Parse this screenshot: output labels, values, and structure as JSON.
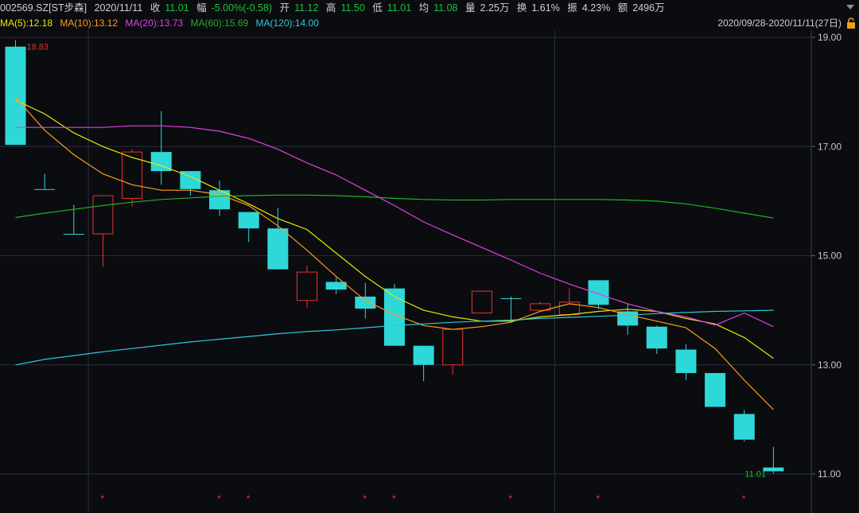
{
  "header": {
    "code": "002569.SZ[ST步森]",
    "date": "2020/11/11",
    "close_label": "收",
    "close": "11.01",
    "change_label": "幅",
    "change": "-5.00%(-0.58)",
    "open_label": "开",
    "open": "11.12",
    "high_label": "高",
    "high": "11.50",
    "low_label": "低",
    "low": "11.01",
    "avg_label": "均",
    "avg": "11.08",
    "vol_label": "量",
    "vol": "2.25万",
    "turnover_label": "换",
    "turnover": "1.61%",
    "amp_label": "振",
    "amp": "4.23%",
    "amount_label": "额",
    "amount": "2496万"
  },
  "ma_legend": [
    {
      "label": "MA(5):12.18",
      "color": "#e8e800"
    },
    {
      "label": "MA(10):13.12",
      "color": "#ff9c1a"
    },
    {
      "label": "MA(20):13.73",
      "color": "#e040e0"
    },
    {
      "label": "MA(60):15.69",
      "color": "#22b022"
    },
    {
      "label": "MA(120):14.00",
      "color": "#30c8d8"
    }
  ],
  "range_text": "2020/09/28-2020/11/11(27日)",
  "icons": {
    "dropdown": "chevron-down-icon",
    "lock": "lock-icon"
  },
  "colors": {
    "up": "#e8342e",
    "down": "#2ed8d8",
    "grid": "#2a2f3a",
    "axis_text": "#c8c8c8"
  },
  "chart_data": {
    "type": "candlestick",
    "ylim": [
      10.6,
      19.1
    ],
    "yticks": [
      "19.00",
      "17.00",
      "15.00",
      "13.00",
      "11.00"
    ],
    "max_label": "18.83",
    "min_label": "11.01",
    "candles": [
      {
        "o": 18.83,
        "c": 17.03,
        "h": 18.95,
        "l": 17.03
      },
      {
        "o": 16.22,
        "c": 16.22,
        "h": 16.5,
        "l": 16.22
      },
      {
        "o": 15.4,
        "c": 15.4,
        "h": 15.93,
        "l": 15.4
      },
      {
        "o": 15.4,
        "c": 16.1,
        "h": 16.1,
        "l": 14.8
      },
      {
        "o": 16.05,
        "c": 16.9,
        "h": 16.95,
        "l": 15.9
      },
      {
        "o": 16.9,
        "c": 16.55,
        "h": 17.65,
        "l": 16.3
      },
      {
        "o": 16.55,
        "c": 16.22,
        "h": 16.55,
        "l": 16.1
      },
      {
        "o": 16.2,
        "c": 15.85,
        "h": 16.38,
        "l": 15.73
      },
      {
        "o": 15.8,
        "c": 15.5,
        "h": 15.8,
        "l": 15.25
      },
      {
        "o": 15.5,
        "c": 14.75,
        "h": 15.88,
        "l": 14.75
      },
      {
        "o": 14.18,
        "c": 14.7,
        "h": 14.82,
        "l": 14.05
      },
      {
        "o": 14.52,
        "c": 14.38,
        "h": 14.62,
        "l": 14.3
      },
      {
        "o": 14.25,
        "c": 14.03,
        "h": 14.5,
        "l": 13.85
      },
      {
        "o": 14.4,
        "c": 13.35,
        "h": 14.48,
        "l": 13.35
      },
      {
        "o": 13.35,
        "c": 13.0,
        "h": 13.35,
        "l": 12.7
      },
      {
        "o": 13.0,
        "c": 13.65,
        "h": 13.65,
        "l": 12.82
      },
      {
        "o": 13.95,
        "c": 14.35,
        "h": 14.35,
        "l": 13.95
      },
      {
        "o": 14.22,
        "c": 14.22,
        "h": 14.25,
        "l": 13.78
      },
      {
        "o": 14.0,
        "c": 14.12,
        "h": 14.16,
        "l": 13.98
      },
      {
        "o": 13.92,
        "c": 14.15,
        "h": 14.4,
        "l": 13.9
      },
      {
        "o": 14.55,
        "c": 14.1,
        "h": 14.55,
        "l": 14.02
      },
      {
        "o": 13.98,
        "c": 13.72,
        "h": 14.12,
        "l": 13.55
      },
      {
        "o": 13.7,
        "c": 13.3,
        "h": 13.72,
        "l": 13.2
      },
      {
        "o": 13.28,
        "c": 12.85,
        "h": 13.38,
        "l": 12.72
      },
      {
        "o": 12.85,
        "c": 12.23,
        "h": 12.85,
        "l": 12.23
      },
      {
        "o": 12.1,
        "c": 11.63,
        "h": 12.18,
        "l": 11.6
      },
      {
        "o": 11.12,
        "c": 11.05,
        "h": 11.5,
        "l": 11.01
      }
    ],
    "series": [
      {
        "name": "MA(5)",
        "color": "#e8e800",
        "values": [
          17.85,
          17.6,
          17.25,
          17.0,
          16.8,
          16.65,
          16.45,
          16.2,
          15.95,
          15.68,
          15.48,
          15.05,
          14.62,
          14.25,
          14.0,
          13.88,
          13.8,
          13.8,
          13.88,
          13.92,
          13.98,
          14.02,
          13.98,
          13.85,
          13.75,
          13.5,
          13.12
        ]
      },
      {
        "name": "MA(10)",
        "color": "#ff9c1a",
        "values": [
          17.9,
          17.3,
          16.85,
          16.5,
          16.3,
          16.2,
          16.2,
          16.12,
          15.92,
          15.55,
          15.1,
          14.62,
          14.18,
          13.92,
          13.72,
          13.65,
          13.7,
          13.78,
          13.98,
          14.12,
          14.05,
          13.92,
          13.8,
          13.68,
          13.3,
          12.72,
          12.18
        ]
      },
      {
        "name": "MA(20)",
        "color": "#e040e0",
        "values": [
          17.35,
          17.35,
          17.35,
          17.35,
          17.38,
          17.38,
          17.35,
          17.28,
          17.15,
          16.95,
          16.7,
          16.48,
          16.2,
          15.92,
          15.62,
          15.38,
          15.15,
          14.92,
          14.68,
          14.48,
          14.3,
          14.12,
          13.98,
          13.88,
          13.73,
          13.95,
          13.7
        ]
      },
      {
        "name": "MA(60)",
        "color": "#22b022",
        "values": [
          15.7,
          15.78,
          15.85,
          15.92,
          15.98,
          16.03,
          16.06,
          16.09,
          16.1,
          16.11,
          16.11,
          16.1,
          16.08,
          16.05,
          16.03,
          16.02,
          16.02,
          16.03,
          16.03,
          16.03,
          16.03,
          16.02,
          16.0,
          15.95,
          15.87,
          15.78,
          15.69
        ]
      },
      {
        "name": "MA(120)",
        "color": "#30c8d8",
        "values": [
          13.0,
          13.1,
          13.17,
          13.24,
          13.3,
          13.36,
          13.42,
          13.47,
          13.52,
          13.57,
          13.61,
          13.64,
          13.68,
          13.72,
          13.75,
          13.78,
          13.8,
          13.82,
          13.85,
          13.87,
          13.89,
          13.91,
          13.94,
          13.96,
          13.98,
          13.99,
          14.0
        ]
      }
    ],
    "star_markers": [
      3,
      7,
      8,
      12,
      13,
      17,
      20,
      25
    ],
    "star_glyph": "*",
    "vertical_grid_after": [
      2,
      18
    ]
  }
}
